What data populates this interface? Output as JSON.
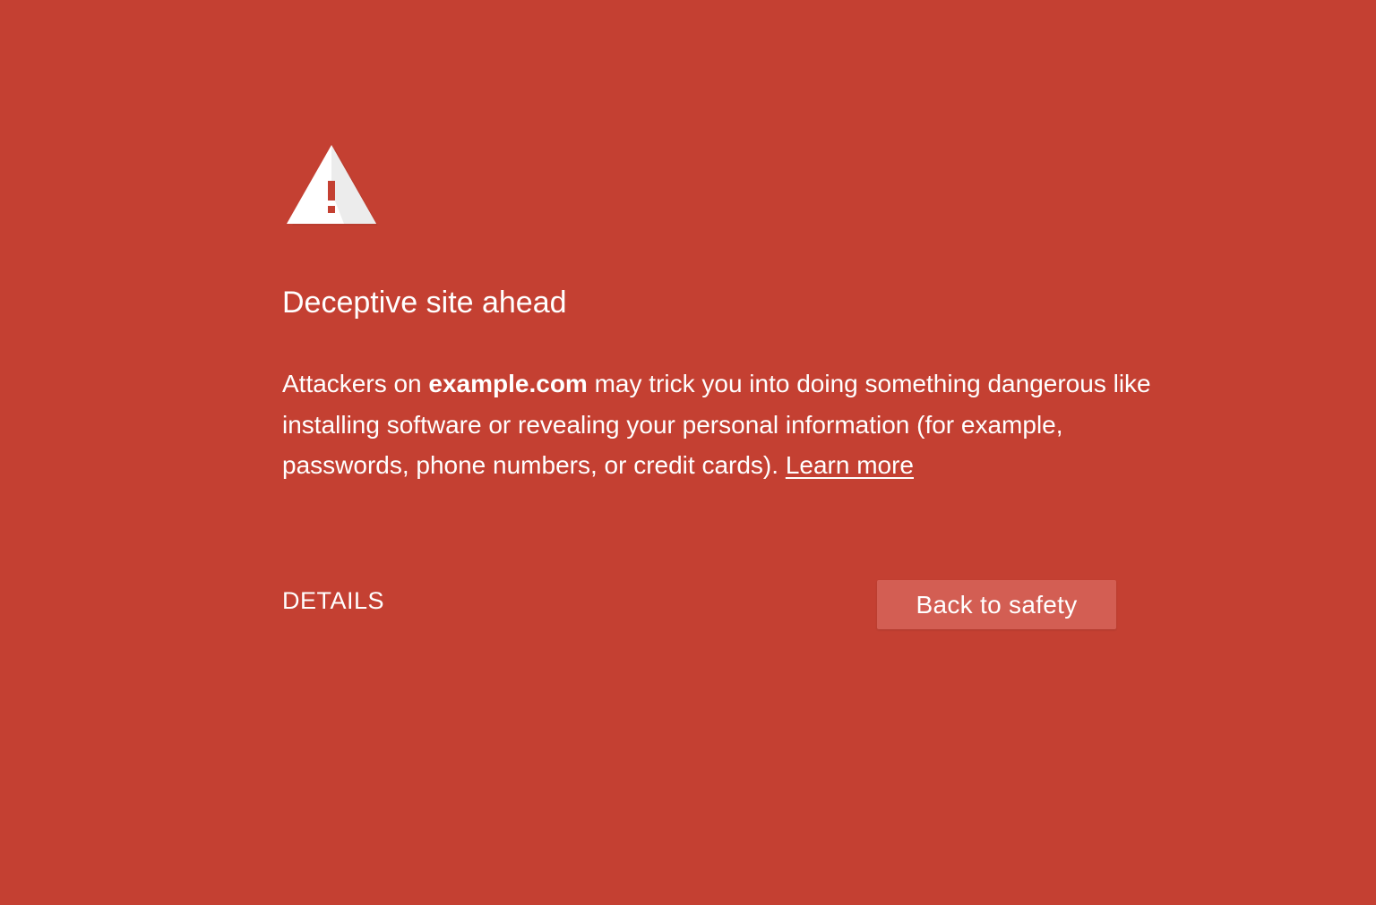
{
  "interstitial": {
    "icon": "warning-triangle-icon",
    "title": "Deceptive site ahead",
    "message": {
      "prefix": "Attackers on ",
      "domain": "example.com",
      "suffix": " may trick you into doing something dangerous like installing software or revealing your personal information (for example, passwords, phone numbers, or credit cards). ",
      "learn_more": "Learn more"
    },
    "details_label": "DETAILS",
    "primary_button_label": "Back to safety"
  },
  "colors": {
    "background": "#c44032",
    "button_background": "#d35e53",
    "text": "#ffffff"
  }
}
